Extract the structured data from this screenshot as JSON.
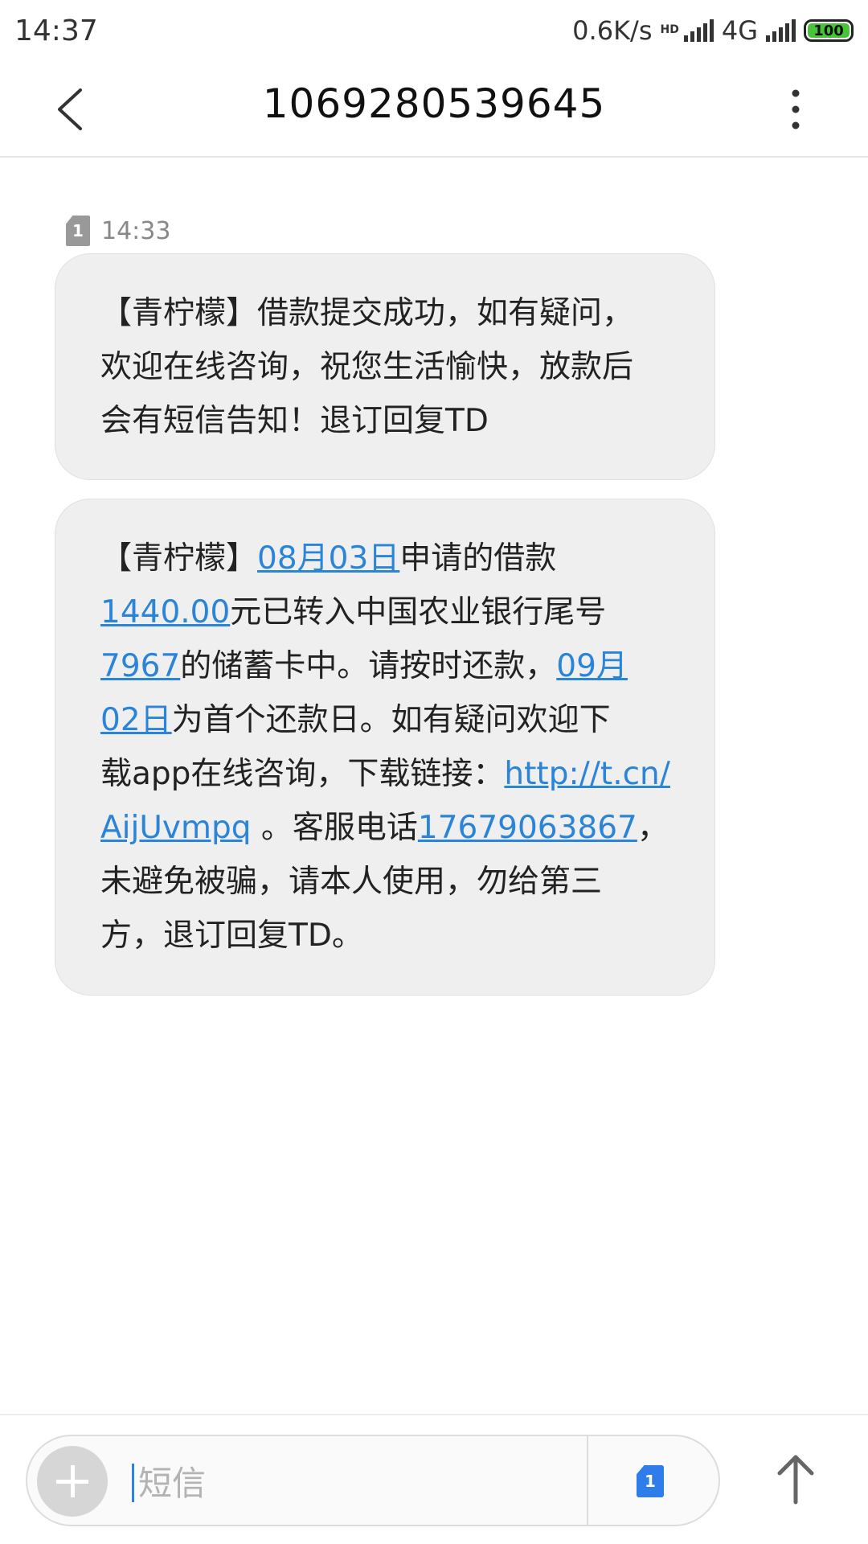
{
  "status_bar": {
    "time": "14:37",
    "net_speed": "0.6K/s",
    "hd_label": "HD",
    "network_type": "4G",
    "battery_level": "100",
    "battery_color": "#47c43a"
  },
  "header": {
    "back_icon": "chevron-left-icon",
    "title": "1069280539645",
    "more_icon": "more-vertical-icon"
  },
  "messages": [
    {
      "sim": "1",
      "time": "14:33",
      "lines": [
        "【青柠檬】借款提交成功，如有疑问，",
        "欢迎在线咨询，祝您生活愉快，放款后",
        "会有短信告知！退订回复TD"
      ]
    },
    {
      "segments": {
        "p1": "【青柠檬】",
        "date1": "08月03日",
        "p2": "申请的借款",
        "amount": "1440.00",
        "p3": "元已转入中国农业银行尾号",
        "card": "7967",
        "p4": "的储蓄卡中。请按时还款，",
        "date2a": "09月",
        "date2b": "02日",
        "p5": "为首个还款日。如有疑问欢迎下",
        "p6": "载app在线咨询，下载链接：",
        "url_a": "http://t.cn/",
        "url_b": "AijUvmpq",
        "p7": " 。客服电话",
        "phone": "17679063867",
        "p8": "，",
        "p9": "未避免被骗，请本人使用，勿给第三",
        "p10": "方，退订回复TD。"
      }
    }
  ],
  "composer": {
    "add_icon": "plus-icon",
    "placeholder": "短信",
    "sim_label": "1",
    "sim_color": "#2e7dea",
    "send_icon": "arrow-up-icon"
  },
  "colors": {
    "link": "#2a84d8",
    "bubble": "#efefef"
  }
}
